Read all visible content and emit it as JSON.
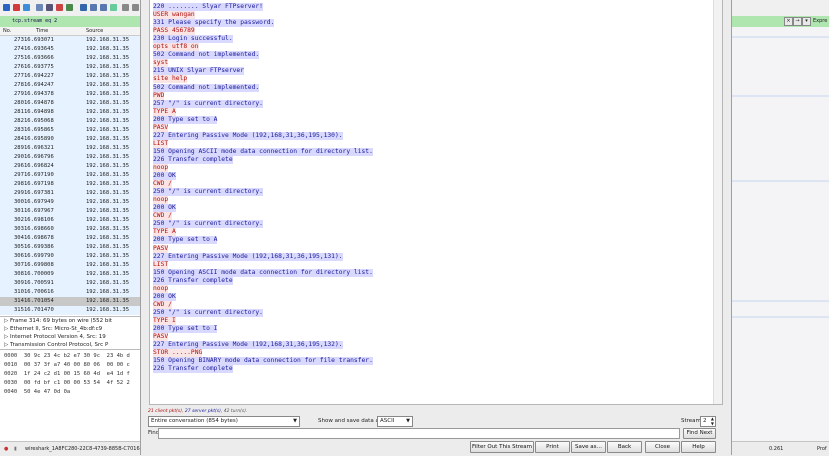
{
  "filter": {
    "text": "tcp.stream eq 2",
    "expression_label": "Expre"
  },
  "packet_list": {
    "headers": [
      "No.",
      "Time",
      "Source"
    ],
    "rows": [
      {
        "no": "273",
        "time": "16.693071",
        "src": "192.168.31.35"
      },
      {
        "no": "274",
        "time": "16.693645",
        "src": "192.168.31.35"
      },
      {
        "no": "275",
        "time": "16.693666",
        "src": "192.168.31.35"
      },
      {
        "no": "276",
        "time": "16.693775",
        "src": "192.168.31.35"
      },
      {
        "no": "277",
        "time": "16.694227",
        "src": "192.168.31.35"
      },
      {
        "no": "278",
        "time": "16.694247",
        "src": "192.168.31.35"
      },
      {
        "no": "279",
        "time": "16.694378",
        "src": "192.168.31.35"
      },
      {
        "no": "280",
        "time": "16.694878",
        "src": "192.168.31.35"
      },
      {
        "no": "281",
        "time": "16.694898",
        "src": "192.168.31.35"
      },
      {
        "no": "282",
        "time": "16.695068",
        "src": "192.168.31.35"
      },
      {
        "no": "283",
        "time": "16.695865",
        "src": "192.168.31.35"
      },
      {
        "no": "284",
        "time": "16.695890",
        "src": "192.168.31.35"
      },
      {
        "no": "289",
        "time": "16.696321",
        "src": "192.168.31.35"
      },
      {
        "no": "290",
        "time": "16.696796",
        "src": "192.168.31.35"
      },
      {
        "no": "296",
        "time": "16.696824",
        "src": "192.168.31.35"
      },
      {
        "no": "297",
        "time": "16.697190",
        "src": "192.168.31.35"
      },
      {
        "no": "298",
        "time": "16.697198",
        "src": "192.168.31.35"
      },
      {
        "no": "299",
        "time": "16.697381",
        "src": "192.168.31.35"
      },
      {
        "no": "300",
        "time": "16.697949",
        "src": "192.168.31.35"
      },
      {
        "no": "301",
        "time": "16.697967",
        "src": "192.168.31.35"
      },
      {
        "no": "302",
        "time": "16.698106",
        "src": "192.168.31.35"
      },
      {
        "no": "303",
        "time": "16.698660",
        "src": "192.168.31.35"
      },
      {
        "no": "304",
        "time": "16.698678",
        "src": "192.168.31.35"
      },
      {
        "no": "305",
        "time": "16.699386",
        "src": "192.168.31.35"
      },
      {
        "no": "306",
        "time": "16.699790",
        "src": "192.168.31.35"
      },
      {
        "no": "307",
        "time": "16.699808",
        "src": "192.168.31.35"
      },
      {
        "no": "308",
        "time": "16.700009",
        "src": "192.168.31.35"
      },
      {
        "no": "309",
        "time": "16.700591",
        "src": "192.168.31.35"
      },
      {
        "no": "310",
        "time": "16.700616",
        "src": "192.168.31.35"
      },
      {
        "no": "314",
        "time": "16.701054",
        "src": "192.168.31.35"
      },
      {
        "no": "315",
        "time": "16.701470",
        "src": "192.168.31.35"
      }
    ]
  },
  "details": [
    "Frame 314: 69 bytes on wire (552 bit",
    "Ethernet II, Src: Micro-St_4b:df:c9",
    "Internet Protocol Version 4, Src: 19",
    "Transmission Control Protocol, Src P"
  ],
  "hex": [
    {
      "off": "0000",
      "bytes": "30 9c 23 4c b2 e7 30 9c  23 4b d"
    },
    {
      "off": "0010",
      "bytes": "00 37 3f a7 40 00 80 06  00 00 c"
    },
    {
      "off": "0020",
      "bytes": "1f 24 c2 d1 00 15 60 4d  e4 1d f"
    },
    {
      "off": "0030",
      "bytes": "00 fd bf c1 00 00 53 54  4f 52 2"
    },
    {
      "off": "0040",
      "bytes": "50 4e 47 0d 0a"
    }
  ],
  "status": {
    "file": "wireshark_1A8FC280-22C8-4739-885B-C7016460",
    "right_value": "0.261",
    "right_label": "Prof"
  },
  "dialog": {
    "stream_lines": [
      {
        "t": "220 ........ Slyar FTPserver!",
        "k": "srv"
      },
      {
        "t": "USER wangan",
        "k": "cli"
      },
      {
        "t": "331 Please specify the password.",
        "k": "srv"
      },
      {
        "t": "PASS 456789",
        "k": "cli"
      },
      {
        "t": "230 Login successful.",
        "k": "srv"
      },
      {
        "t": "opts utf8 on",
        "k": "cli"
      },
      {
        "t": "502 Command not implemented.",
        "k": "srv"
      },
      {
        "t": "syst",
        "k": "cli"
      },
      {
        "t": "215 UNIX Slyar FTPserver",
        "k": "srv"
      },
      {
        "t": "site help",
        "k": "cli"
      },
      {
        "t": "502 Command not implemented.",
        "k": "srv"
      },
      {
        "t": "PWD",
        "k": "cli"
      },
      {
        "t": "257 \"/\" is current directory.",
        "k": "srv"
      },
      {
        "t": "TYPE A",
        "k": "cli"
      },
      {
        "t": "200 Type set to A",
        "k": "srv"
      },
      {
        "t": "PASV",
        "k": "cli"
      },
      {
        "t": "227 Entering Passive Mode (192,168,31,36,195,130).",
        "k": "srv"
      },
      {
        "t": "LIST",
        "k": "cli"
      },
      {
        "t": "150 Opening ASCII mode data connection for directory list.",
        "k": "srv"
      },
      {
        "t": "226 Transfer complete",
        "k": "srv"
      },
      {
        "t": "noop",
        "k": "cli"
      },
      {
        "t": "200 OK",
        "k": "srv"
      },
      {
        "t": "CWD /",
        "k": "cli"
      },
      {
        "t": "250 \"/\" is current directory.",
        "k": "srv"
      },
      {
        "t": "noop",
        "k": "cli"
      },
      {
        "t": "200 OK",
        "k": "srv"
      },
      {
        "t": "CWD /",
        "k": "cli"
      },
      {
        "t": "250 \"/\" is current directory.",
        "k": "srv"
      },
      {
        "t": "TYPE A",
        "k": "cli"
      },
      {
        "t": "200 Type set to A",
        "k": "srv"
      },
      {
        "t": "PASV",
        "k": "cli"
      },
      {
        "t": "227 Entering Passive Mode (192,168,31,36,195,131).",
        "k": "srv"
      },
      {
        "t": "LIST",
        "k": "cli"
      },
      {
        "t": "150 Opening ASCII mode data connection for directory list.",
        "k": "srv"
      },
      {
        "t": "226 Transfer complete",
        "k": "srv"
      },
      {
        "t": "noop",
        "k": "cli"
      },
      {
        "t": "200 OK",
        "k": "srv"
      },
      {
        "t": "CWD /",
        "k": "cli"
      },
      {
        "t": "250 \"/\" is current directory.",
        "k": "srv"
      },
      {
        "t": "TYPE I",
        "k": "cli"
      },
      {
        "t": "200 Type set to I",
        "k": "srv"
      },
      {
        "t": "PASV",
        "k": "cli"
      },
      {
        "t": "227 Entering Passive Mode (192,168,31,36,195,132).",
        "k": "srv"
      },
      {
        "t": "STOR .....PNG",
        "k": "cli"
      },
      {
        "t": "150 Opening BINARY mode data connection for file transfer.",
        "k": "srv"
      },
      {
        "t": "226 Transfer complete",
        "k": "srv"
      }
    ],
    "summary": {
      "client": "21 client pkt(s),",
      "server": "27 server pkt(s),",
      "turns": "42 turn(s)."
    },
    "conversation_value": "Entire conversation (854 bytes)",
    "show_save_label": "Show and save data as",
    "format_value": "ASCII",
    "stream_label": "Stream",
    "stream_number": "2",
    "find_label": "Find",
    "find_value": "",
    "find_next_label": "Find Next",
    "buttons": {
      "filter_out": "Filter Out This Stream",
      "print": "Print",
      "save_as": "Save as…",
      "back": "Back",
      "close": "Close",
      "help": "Help"
    }
  },
  "colors": {
    "client_fg": "#b01010",
    "client_bg": "#fbe4e4",
    "server_fg": "#1a1a99",
    "server_bg": "#d9d9ff",
    "filter_bg": "#afe6af"
  }
}
